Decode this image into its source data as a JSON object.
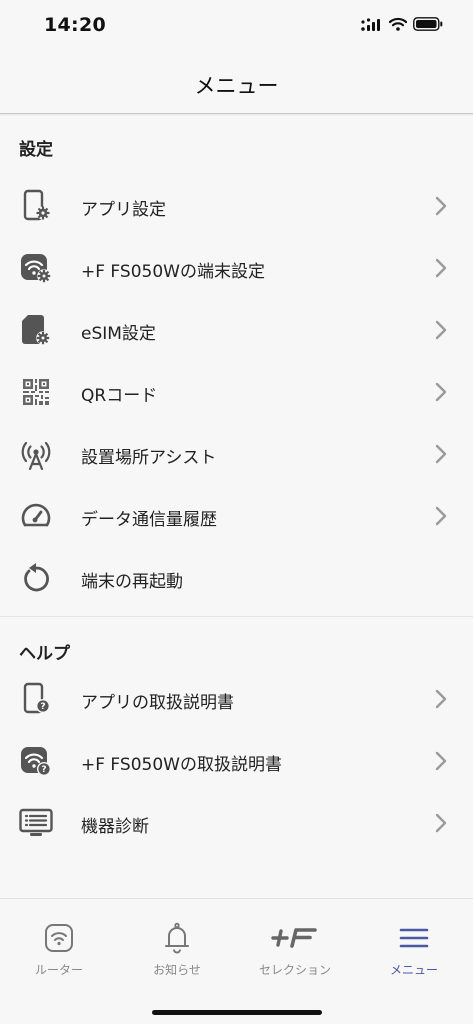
{
  "status": {
    "time": "14:20"
  },
  "nav": {
    "title": "メニュー"
  },
  "settings": {
    "header": "設定",
    "items": [
      {
        "label": "アプリ設定",
        "icon": "phone-gear-icon"
      },
      {
        "label": "+F FS050Wの端末設定",
        "icon": "router-gear-icon"
      },
      {
        "label": "eSIM設定",
        "icon": "sim-gear-icon"
      },
      {
        "label": "QRコード",
        "icon": "qr-code-icon"
      },
      {
        "label": "設置場所アシスト",
        "icon": "antenna-icon"
      },
      {
        "label": "データ通信量履歴",
        "icon": "speedometer-icon"
      },
      {
        "label": "端末の再起動",
        "icon": "restart-icon"
      }
    ]
  },
  "help": {
    "header": "ヘルプ",
    "items": [
      {
        "label": "アプリの取扱説明書",
        "icon": "phone-help-icon"
      },
      {
        "label": "+F FS050Wの取扱説明書",
        "icon": "router-help-icon"
      },
      {
        "label": "機器診断",
        "icon": "diagnostics-icon"
      }
    ]
  },
  "tabs": [
    {
      "label": "ルーター",
      "icon": "router-wifi-icon"
    },
    {
      "label": "お知らせ",
      "icon": "bell-icon"
    },
    {
      "label": "セレクション",
      "icon": "plus-f-logo-icon"
    },
    {
      "label": "メニュー",
      "icon": "hamburger-menu-icon"
    }
  ],
  "colors": {
    "accent": "#4a59a6",
    "icon_gray": "#555555",
    "chevron": "#9a9a9a"
  }
}
